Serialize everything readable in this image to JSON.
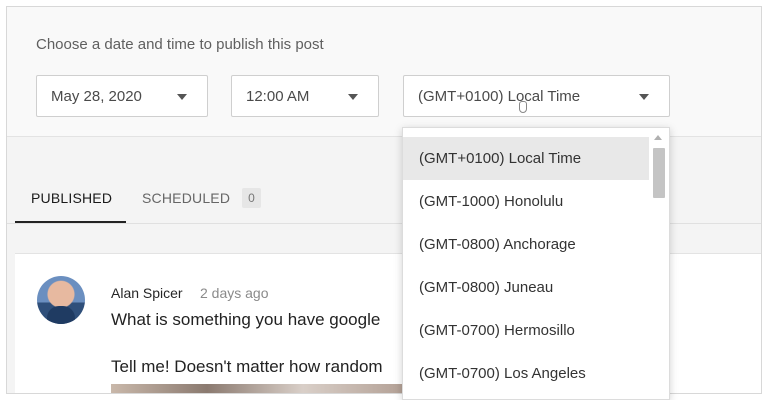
{
  "schedule": {
    "title": "Choose a date and time to publish this post",
    "date": "May 28, 2020",
    "time": "12:00 AM",
    "timezone": "(GMT+0100) Local Time"
  },
  "tabs": {
    "published": "PUBLISHED",
    "scheduled": "SCHEDULED",
    "scheduled_count": "0"
  },
  "post": {
    "author": "Alan Spicer",
    "time": "2 days ago",
    "line1": "What is something you have google",
    "line2": "Tell me! Doesn't matter how random"
  },
  "timezone_dropdown": {
    "options": [
      "(GMT+0100) Local Time",
      "(GMT-1000) Honolulu",
      "(GMT-0800) Anchorage",
      "(GMT-0800) Juneau",
      "(GMT-0700) Hermosillo",
      "(GMT-0700) Los Angeles"
    ],
    "selected_index": 0
  },
  "colors": {
    "panel_bg": "#f9f9f9",
    "selected_option_bg": "#e8e8e8",
    "tab_underline": "#222222"
  }
}
